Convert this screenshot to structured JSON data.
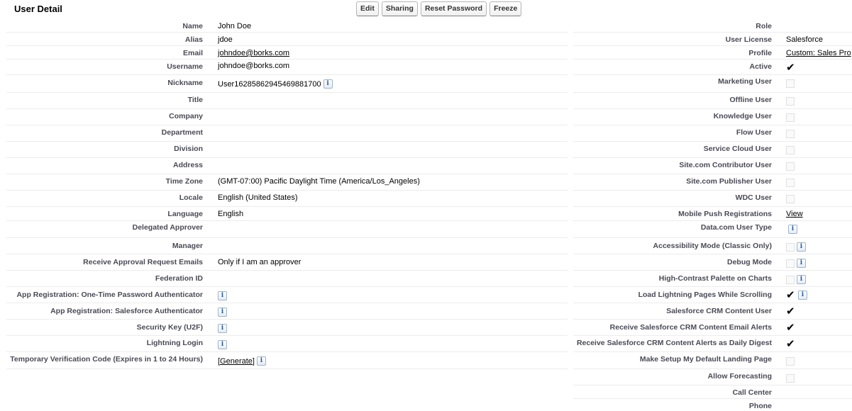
{
  "section_title": "User Detail",
  "buttons": {
    "edit": "Edit",
    "sharing": "Sharing",
    "reset_password": "Reset Password",
    "freeze": "Freeze"
  },
  "left": {
    "name": {
      "label": "Name",
      "value": "John Doe"
    },
    "alias": {
      "label": "Alias",
      "value": "jdoe"
    },
    "email": {
      "label": "Email",
      "value": "johndoe@borks.com"
    },
    "username": {
      "label": "Username",
      "value": "johndoe@borks.com"
    },
    "nickname": {
      "label": "Nickname",
      "value": "User16285862945469881700"
    },
    "title": {
      "label": "Title",
      "value": ""
    },
    "company": {
      "label": "Company",
      "value": ""
    },
    "department": {
      "label": "Department",
      "value": ""
    },
    "division": {
      "label": "Division",
      "value": ""
    },
    "address": {
      "label": "Address",
      "value": ""
    },
    "time_zone": {
      "label": "Time Zone",
      "value": "(GMT-07:00) Pacific Daylight Time (America/Los_Angeles)"
    },
    "locale": {
      "label": "Locale",
      "value": "English (United States)"
    },
    "language": {
      "label": "Language",
      "value": "English"
    },
    "delegated_approver": {
      "label": "Delegated Approver",
      "value": ""
    },
    "manager": {
      "label": "Manager",
      "value": ""
    },
    "approval_emails": {
      "label": "Receive Approval Request Emails",
      "value": "Only if I am an approver"
    },
    "federation_id": {
      "label": "Federation ID",
      "value": ""
    },
    "app_reg_otp": {
      "label": "App Registration: One-Time Password Authenticator"
    },
    "app_reg_sf": {
      "label": "App Registration: Salesforce Authenticator"
    },
    "security_key": {
      "label": "Security Key (U2F)"
    },
    "lightning_login": {
      "label": "Lightning Login"
    },
    "temp_code": {
      "label": "Temporary Verification Code (Expires in 1 to 24 Hours)",
      "link": "[Generate]"
    }
  },
  "right": {
    "role": {
      "label": "Role",
      "value": ""
    },
    "user_license": {
      "label": "User License",
      "value": "Salesforce"
    },
    "profile": {
      "label": "Profile",
      "value": "Custom: Sales Pro"
    },
    "active": {
      "label": "Active",
      "checked": true
    },
    "marketing_user": {
      "label": "Marketing User",
      "checked": false
    },
    "offline_user": {
      "label": "Offline User",
      "checked": false
    },
    "knowledge_user": {
      "label": "Knowledge User",
      "checked": false
    },
    "flow_user": {
      "label": "Flow User",
      "checked": false
    },
    "service_cloud_user": {
      "label": "Service Cloud User",
      "checked": false
    },
    "site_contributor": {
      "label": "Site.com Contributor User",
      "checked": false
    },
    "site_publisher": {
      "label": "Site.com Publisher User",
      "checked": false
    },
    "wdc_user": {
      "label": "WDC User",
      "checked": false
    },
    "mobile_push": {
      "label": "Mobile Push Registrations",
      "link": "View"
    },
    "datacom_user_type": {
      "label": "Data.com User Type"
    },
    "accessibility_mode": {
      "label": "Accessibility Mode (Classic Only)",
      "checked": false
    },
    "debug_mode": {
      "label": "Debug Mode",
      "checked": false
    },
    "high_contrast": {
      "label": "High-Contrast Palette on Charts",
      "checked": false
    },
    "load_lightning": {
      "label": "Load Lightning Pages While Scrolling",
      "checked": true
    },
    "crm_content_user": {
      "label": "Salesforce CRM Content User",
      "checked": true
    },
    "crm_email_alerts": {
      "label": "Receive Salesforce CRM Content Email Alerts",
      "checked": true
    },
    "crm_daily_digest": {
      "label": "Receive Salesforce CRM Content Alerts as Daily Digest",
      "checked": true
    },
    "default_landing": {
      "label": "Make Setup My Default Landing Page",
      "checked": false
    },
    "allow_forecasting": {
      "label": "Allow Forecasting",
      "checked": false
    },
    "call_center": {
      "label": "Call Center",
      "value": ""
    },
    "phone": {
      "label": "Phone",
      "value": ""
    }
  },
  "icons": {
    "info": "i",
    "check": "✔"
  }
}
